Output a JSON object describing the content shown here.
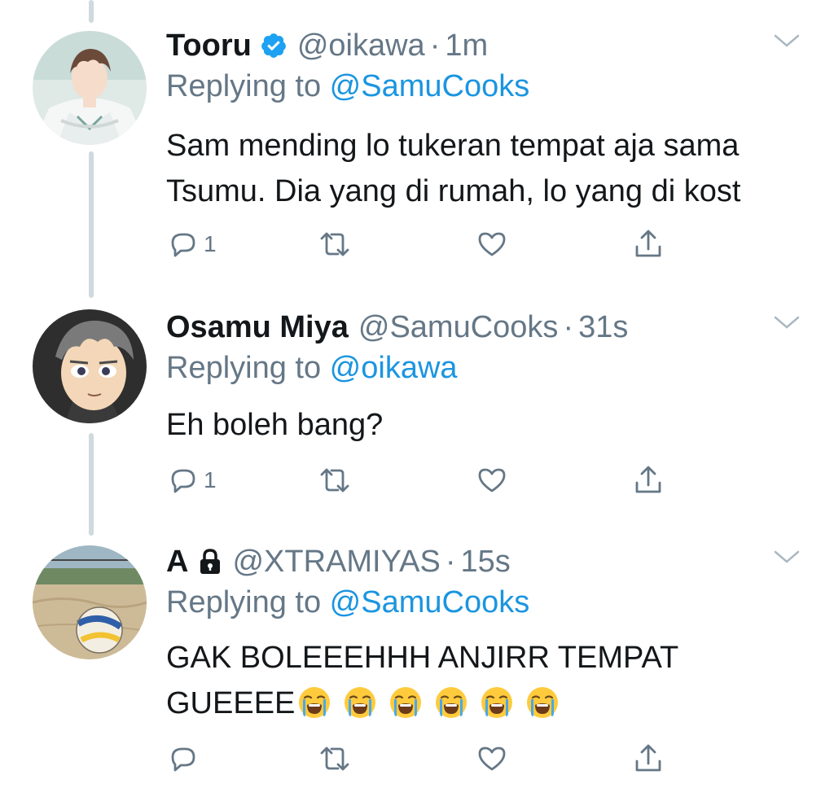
{
  "tweets": [
    {
      "name": "Tooru",
      "verified": true,
      "handle": "@oikawa",
      "dot": "·",
      "time": "1m",
      "replying_prefix": "Replying to ",
      "replying_to": "@SamuCooks",
      "text": "Sam mending lo tukeran tempat aja sama Tsumu. Dia yang di rumah, lo yang di kost",
      "reply_count": "1",
      "avatar_icon": "anime-character-avatar"
    },
    {
      "name": "Osamu Miya",
      "verified": false,
      "handle": "@SamuCooks",
      "dot": "·",
      "time": "31s",
      "replying_prefix": "Replying to ",
      "replying_to": "@oikawa",
      "text": "Eh boleh bang?",
      "reply_count": "1",
      "avatar_icon": "anime-character-avatar"
    },
    {
      "name": "A",
      "locked": true,
      "handle": "@XTRAMIYAS",
      "dot": "·",
      "time": "15s",
      "replying_prefix": "Replying to ",
      "replying_to": "@SamuCooks",
      "text": "GAK BOLEEEHHH ANJIRR TEMPAT GUEEEE",
      "emoji_count": 6,
      "emoji_icon": "loudly-crying-face-emoji",
      "reply_count": "",
      "avatar_icon": "volleyball-on-sand-photo"
    }
  ],
  "icons": {
    "reply": "reply-icon",
    "retweet": "retweet-icon",
    "like": "heart-icon",
    "share": "share-icon",
    "more": "chevron-down-icon"
  },
  "colors": {
    "link": "#1b95e0",
    "secondary_text": "#657786",
    "primary_text": "#14171a",
    "verified": "#1da1f2",
    "thread_line": "#cfd9de"
  }
}
